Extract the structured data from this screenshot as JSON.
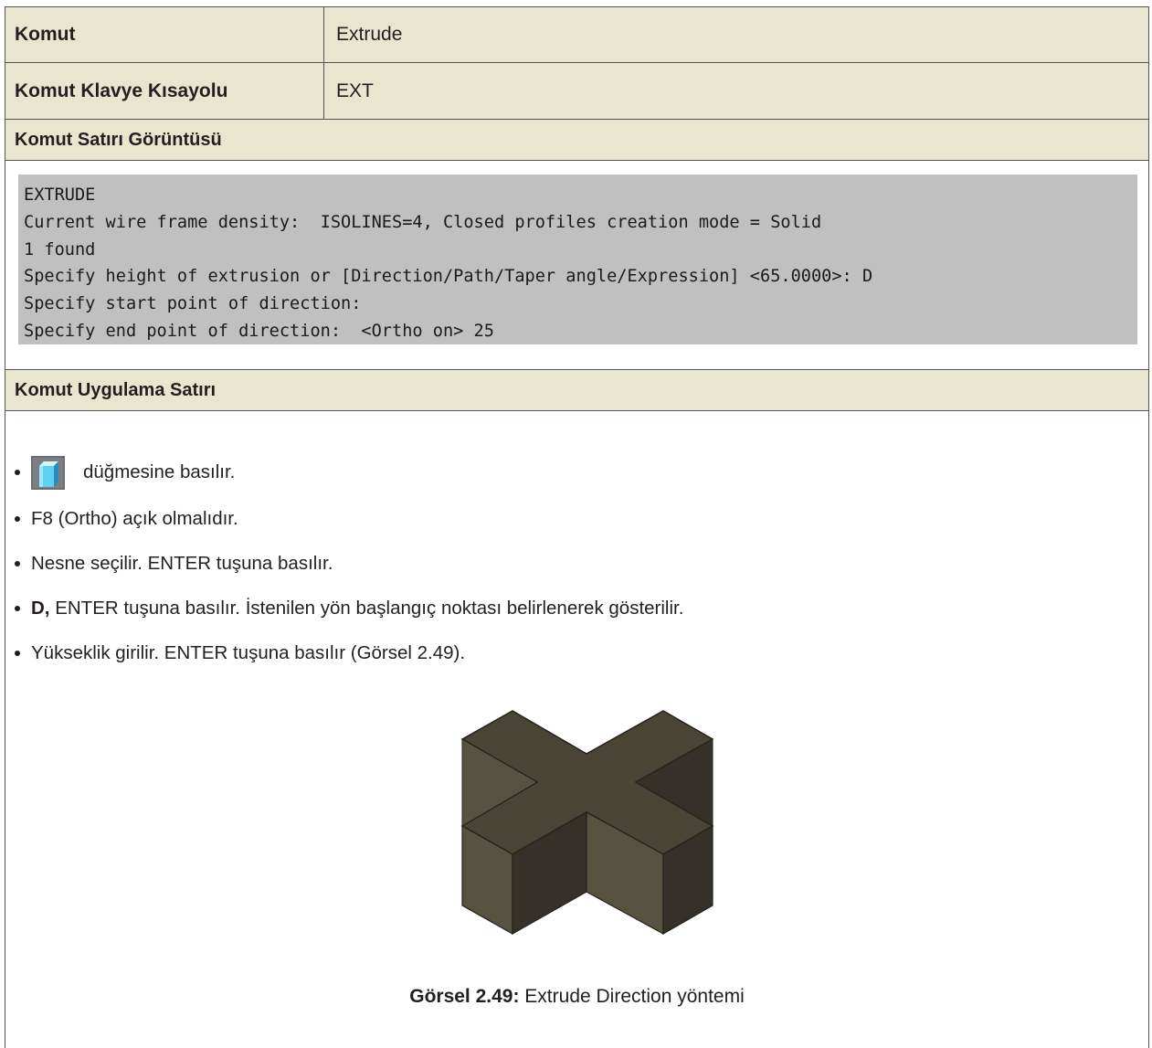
{
  "table": {
    "rows": [
      {
        "label": "Komut",
        "value": "Extrude"
      },
      {
        "label": "Komut Klavye Kısayolu",
        "value": "EXT"
      }
    ],
    "command_line_header": "Komut Satırı Görüntüsü",
    "command_line": [
      "EXTRUDE",
      "Current wire frame density:  ISOLINES=4, Closed profiles creation mode = Solid",
      "1 found",
      "Specify height of extrusion or [Direction/Path/Taper angle/Expression] <65.0000>: D",
      "Specify start point of direction:",
      "Specify end point of direction:  <Ortho on> 25"
    ],
    "application_header": "Komut Uygulama Satırı"
  },
  "steps": {
    "step1_text": "düğmesine basılır.",
    "step1_icon": "extrude-button-icon",
    "step2_text": "F8 (Ortho) açık olmalıdır.",
    "step3_text": "Nesne seçilir. ENTER tuşuna basılır.",
    "step4_bold": "D,",
    "step4_text": " ENTER tuşuna basılır. İstenilen yön başlangıç noktası belirlenerek gösterilir.",
    "step5_text": "Yükseklik girilir. ENTER tuşuna basılır (Görsel 2.49)."
  },
  "figure": {
    "caption_bold": "Görsel 2.49:",
    "caption_text": " Extrude Direction yöntemi",
    "colors": {
      "top": "#4a4435",
      "side_light": "#57513f",
      "side_dark": "#35312a",
      "edge": "#25221b"
    }
  }
}
